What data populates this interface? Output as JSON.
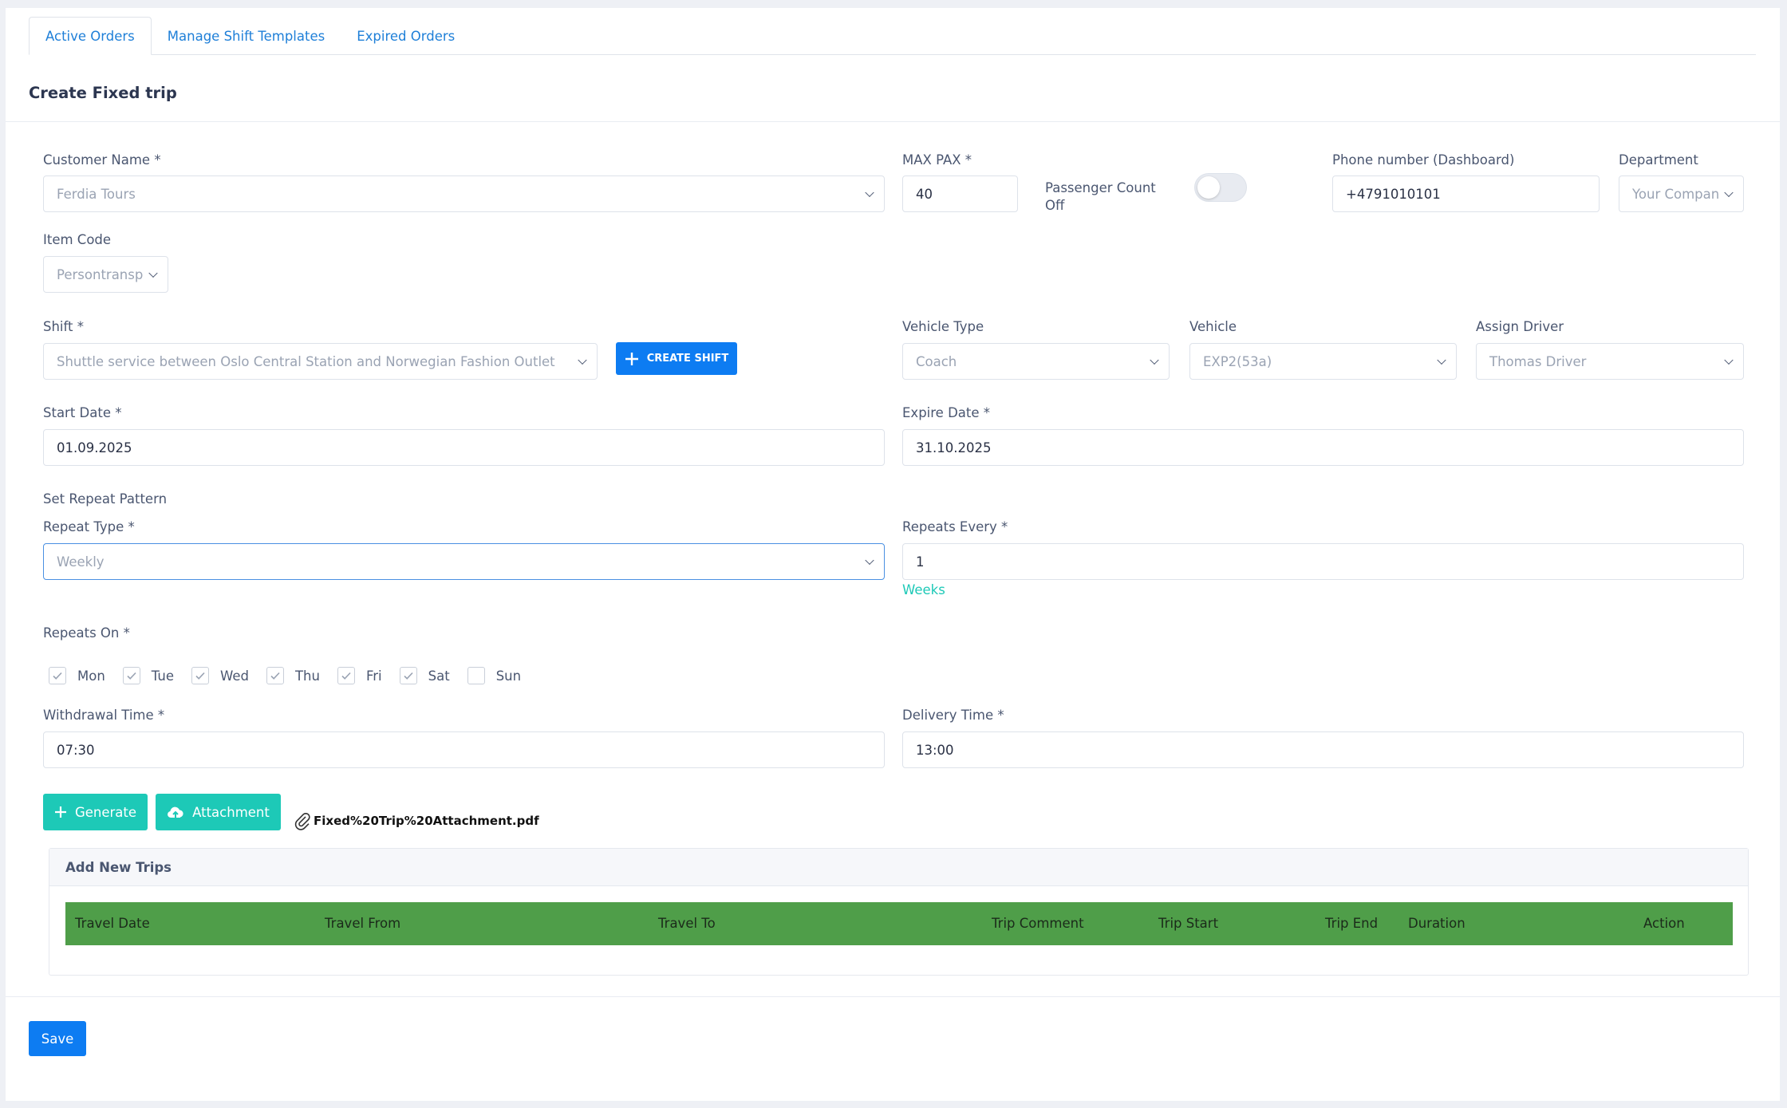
{
  "tabs": [
    "Active Orders",
    "Manage Shift Templates",
    "Expired Orders"
  ],
  "card_title": "Create Fixed trip",
  "customer": {
    "label": "Customer Name *",
    "value": "Ferdia Tours"
  },
  "max_pax": {
    "label": "MAX PAX *",
    "value": "40"
  },
  "passenger_count": {
    "label_line1": "Passenger Count",
    "label_line2": "Off",
    "enabled": false
  },
  "phone": {
    "label": "Phone number (Dashboard)",
    "value": "+4791010101"
  },
  "department": {
    "label": "Department",
    "value": "Your Compan"
  },
  "item_code": {
    "label": "Item Code",
    "value": "Persontransp"
  },
  "shift": {
    "label": "Shift *",
    "value": "Shuttle service between Oslo Central Station and Norwegian Fashion Outlet",
    "create_label": "CREATE SHIFT"
  },
  "vehicle_type": {
    "label": "Vehicle Type",
    "value": "Coach"
  },
  "vehicle": {
    "label": "Vehicle",
    "value": "EXP2(53a)"
  },
  "driver": {
    "label": "Assign Driver",
    "value": "Thomas Driver"
  },
  "start_date": {
    "label": "Start Date *",
    "value": "01.09.2025"
  },
  "expire_date": {
    "label": "Expire Date *",
    "value": "31.10.2025"
  },
  "repeat_pattern_title": "Set Repeat Pattern",
  "repeat_type": {
    "label": "Repeat Type *",
    "value": "Weekly"
  },
  "repeats_every": {
    "label": "Repeats Every *",
    "value": "1",
    "unit": "Weeks"
  },
  "repeats_on": {
    "label": "Repeats On *",
    "days": [
      {
        "name": "Mon",
        "checked": true
      },
      {
        "name": "Tue",
        "checked": true
      },
      {
        "name": "Wed",
        "checked": true
      },
      {
        "name": "Thu",
        "checked": true
      },
      {
        "name": "Fri",
        "checked": true
      },
      {
        "name": "Sat",
        "checked": true
      },
      {
        "name": "Sun",
        "checked": false
      }
    ]
  },
  "withdrawal_time": {
    "label": "Withdrawal Time *",
    "value": "07:30"
  },
  "delivery_time": {
    "label": "Delivery Time *",
    "value": "13:00"
  },
  "buttons": {
    "generate": "Generate",
    "attachment": "Attachment",
    "save": "Save"
  },
  "attachment_file": "Fixed%20Trip%20Attachment.pdf",
  "trips": {
    "title": "Add New Trips",
    "columns": [
      "Travel Date",
      "Travel From",
      "Travel To",
      "Trip Comment",
      "Trip Start",
      "Trip End",
      "Duration",
      "Action"
    ]
  },
  "colors": {
    "primary": "#0d7cf2",
    "teal": "#1dc9b7",
    "table_header": "#4f9e49",
    "link": "#1e7fd8"
  }
}
